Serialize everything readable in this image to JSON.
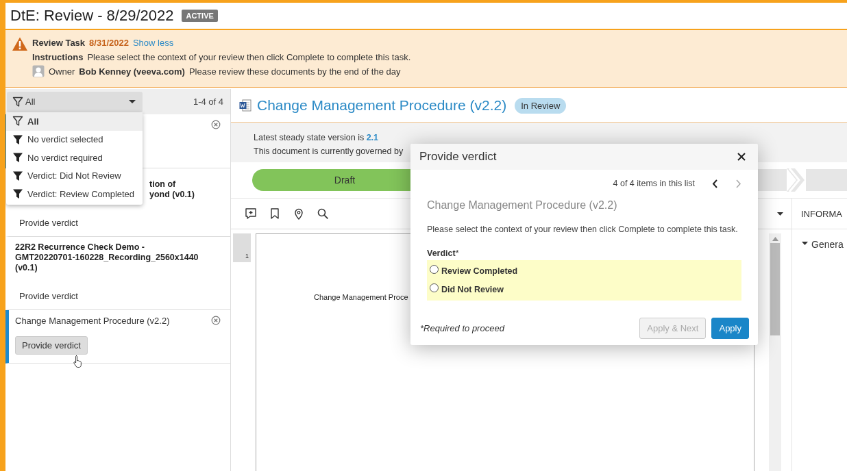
{
  "page": {
    "title": "DtE: Review - 8/29/2022",
    "status": "ACTIVE"
  },
  "task": {
    "label": "Review Task",
    "due": "8/31/2022",
    "toggle": "Show less",
    "instructions_label": "Instructions",
    "instructions": "Please select the context of your review then click Complete to complete this task.",
    "owner_label": "Owner",
    "owner": "Bob Kenney (veeva.com)",
    "owner_note": "Please review these documents by the end of the day"
  },
  "doc_list": {
    "filter": "All",
    "count": "1-4 of 4",
    "filter_menu": [
      {
        "label": "All",
        "selected": true
      },
      {
        "label": "No verdict selected",
        "selected": false
      },
      {
        "label": "No verdict required",
        "selected": false
      },
      {
        "label": "Verdict: Did Not Review",
        "selected": false
      },
      {
        "label": "Verdict: Review Completed",
        "selected": false
      }
    ],
    "items": [
      {
        "removable": true,
        "selected": true,
        "active": false
      },
      {
        "title_lines": [
          "tion of",
          "yond (v0.1)"
        ],
        "action": "Provide verdict",
        "removable": false,
        "selected": false,
        "active": false
      },
      {
        "title_lines": [
          "22R2 Recurrence Check Demo -",
          "GMT20220701-160228_Recording_2560x1440",
          "(v0.1)"
        ],
        "action": "Provide verdict",
        "removable": false,
        "selected": false,
        "active": false
      },
      {
        "title_lines": [
          "Change Management Procedure (v2.2)"
        ],
        "action": "Provide verdict",
        "removable": true,
        "selected": true,
        "active": true
      }
    ]
  },
  "document": {
    "title": "Change Management Procedure (v2.2)",
    "status": "In Review",
    "steady_label": "Latest steady state version is",
    "steady_version": "2.1",
    "governed": "This document is currently governed by",
    "stages": [
      {
        "label": "Draft",
        "reached": true
      }
    ],
    "page_number": "1",
    "page_text": "Change Management Proce"
  },
  "info_panel": {
    "header": "INFORMA",
    "section": "Genera",
    "expanded": true
  },
  "modal": {
    "title": "Provide verdict",
    "position": "4 of 4 items in this list",
    "prev_disabled": false,
    "next_disabled": true,
    "document": "Change Management Procedure (v2.2)",
    "message": "Please select the context of your review then click Complete to complete this task.",
    "field_label": "Verdict",
    "required_mark": "*",
    "options": [
      {
        "label": "Review Completed",
        "selected": false
      },
      {
        "label": "Did Not Review",
        "selected": false
      }
    ],
    "footnote": "*Required to proceed",
    "buttons": [
      {
        "label": "Apply & Next",
        "disabled": true,
        "primary": false
      },
      {
        "label": "Apply",
        "disabled": false,
        "primary": true
      }
    ]
  }
}
